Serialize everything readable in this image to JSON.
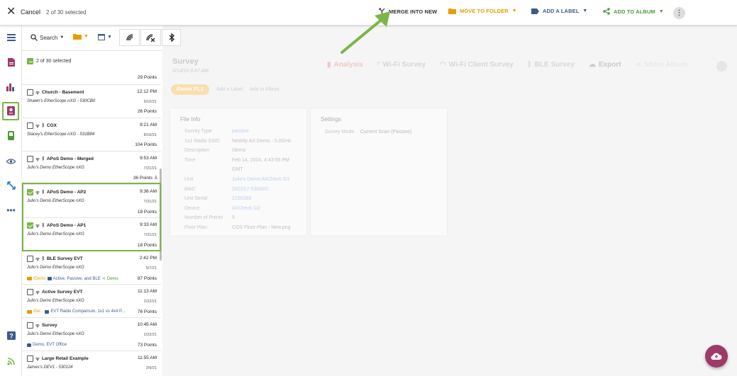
{
  "topbar": {
    "cancel_label": "Cancel",
    "selection_count": "2 of 30 selected",
    "merge_label": "MERGE INTO NEW",
    "move_folder_label": "MOVE TO FOLDER",
    "add_label_label": "ADD A LABEL",
    "add_album_label": "ADD TO ALBUM"
  },
  "list": {
    "search_label": "Search",
    "select_all_label": "2 of 30 selected",
    "top_points": "29 Points",
    "items": [
      {
        "name": "Church - Basement",
        "time": "12:12 PM",
        "device": "Shawn's EtherScope nXG - 530CB0",
        "date": "9/10/21",
        "points": "26 Points"
      },
      {
        "name": "COX",
        "time": "9:21 AM",
        "device": "Stacey's EtherScope nXG - 531B84",
        "date": "8/16/21",
        "points": "104 Points"
      },
      {
        "name": "APoS Demo - Merged",
        "time": "9:53 AM",
        "device": "Julio's Demo EtherScope nXG",
        "date": "7/21/21",
        "points": "36 Points"
      },
      {
        "name": "APoS Demo - AP2",
        "time": "9:36 AM",
        "device": "Julio's Demo EtherScope nXG",
        "date": "7/21/21",
        "points": "18 Points"
      },
      {
        "name": "APoS Demo - AP1",
        "time": "9:33 AM",
        "device": "Julio's Demo EtherScope nXG",
        "date": "7/21/21",
        "points": "18 Points"
      },
      {
        "name": "BLE Survey EVT",
        "time": "2:42 PM",
        "device": "Julio's Demo EtherScope nXG",
        "date": "5/7/21",
        "points": "87 Points",
        "folder": "/Demo",
        "label": "Active, Passive, and BLE",
        "album": "Demo"
      },
      {
        "name": "Active Survey EVT",
        "time": "11:13 AM",
        "device": "Julio's Demo EtherScope nXG",
        "date": "2/22/21",
        "points": "76 Points",
        "folder": "/De...",
        "label": "EVT Radio Comparison, 1x1 vs 4x4 P..."
      },
      {
        "name": "Survey",
        "time": "10:45 AM",
        "device": "Julio's Demo EtherScope nXG",
        "date": "2/22/21",
        "points": "73 Points",
        "label": "Demo, EVT Office"
      },
      {
        "name": "Large Retail Example",
        "time": "11:55 AM",
        "device": "James's DEV1 - 530124",
        "date": "2/9/21"
      }
    ]
  },
  "detail": {
    "title": "Survey",
    "subtitle": "2/14/24 8:47 AM",
    "tabs": [
      "Analysis",
      "Wi-Fi Survey",
      "Wi-Fi Client Survey",
      "BLE Survey",
      "Export",
      "Share Album"
    ],
    "folder_chip": "/Demo /FL1",
    "add_label": "Add a Label",
    "add_album": "Add to Album",
    "file_info": {
      "title": "File Info",
      "rows": [
        {
          "k": "Survey Type",
          "v": "passive",
          "style": "link"
        },
        {
          "k": "1x1 Radio SSID",
          "v": "NetAlly AX Demo - 5.0GHz",
          "style": "plain"
        },
        {
          "k": "Description",
          "v": "/demo",
          "style": "plain"
        },
        {
          "k": "Time",
          "v": "Feb 14, 2024, 4:43:55 PM",
          "style": "plain"
        },
        {
          "k": "",
          "v": "GMT",
          "style": "plain"
        },
        {
          "k": "Unit",
          "v": "Julio's Demo AirCheck G3",
          "style": "link"
        },
        {
          "k": "MAC",
          "v": "00C017-5300DC",
          "style": "link"
        },
        {
          "k": "Unit Serial",
          "v": "2150289",
          "style": "link"
        },
        {
          "k": "Device",
          "v": "AirCheck G3",
          "style": "link"
        },
        {
          "k": "Number of Points",
          "v": "5",
          "style": "plain"
        },
        {
          "k": "Floor Plan",
          "v": "COS Floor Plan - New.png",
          "style": "plain"
        }
      ]
    },
    "settings": {
      "title": "Settings",
      "rows": [
        {
          "k": "Survey Mode",
          "v": "Current Scan (Passive)"
        }
      ]
    }
  },
  "colors": {
    "accent_green": "#7ab648",
    "folder_orange": "#e89c00",
    "label_blue": "#3c5a8a",
    "album_green": "#4a9a3a",
    "fab": "#9e3a6a"
  }
}
